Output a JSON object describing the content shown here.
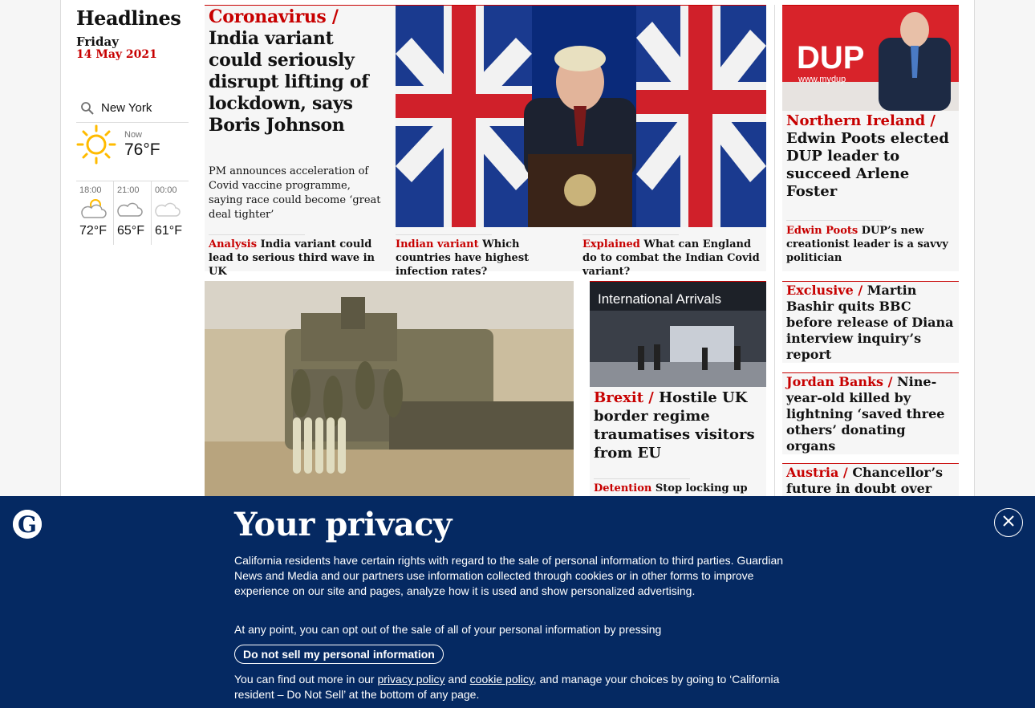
{
  "sidebar": {
    "title": "Headlines",
    "day": "Friday",
    "date": "14 May 2021",
    "weather": {
      "location": "New York",
      "now_label": "Now",
      "now_temp": "76°F",
      "forecast": [
        {
          "time": "18:00",
          "temp": "72°F",
          "icon": "partly-cloudy-icon"
        },
        {
          "time": "21:00",
          "temp": "65°F",
          "icon": "cloud-moon-icon"
        },
        {
          "time": "00:00",
          "temp": "61°F",
          "icon": "cloud-moon-icon"
        }
      ]
    }
  },
  "lead": {
    "kicker": "Coronavirus /",
    "headline": "India variant could seriously disrupt lifting of lockdown, says Boris Johnson",
    "standfirst": "PM announces acceleration of Covid vaccine programme, saying race could become ‘great deal tighter’",
    "sublinks": [
      {
        "kicker": "Analysis",
        "text": "India variant could lead to serious third wave in UK"
      },
      {
        "kicker": "Indian variant",
        "text": "Which countries have highest infection rates?"
      },
      {
        "kicker": "Explained",
        "text": "What can England do to combat the Indian Covid variant?"
      }
    ]
  },
  "ni_story": {
    "image_sign": "DUP",
    "image_url_text": "www.mydup",
    "kicker": "Northern Ireland /",
    "headline": "Edwin Poots elected DUP leader to succeed Arlene Foster",
    "sublink": {
      "kicker": "Edwin Poots",
      "text": "DUP’s new creationist leader is a savvy politician"
    }
  },
  "brexit_story": {
    "image_sign": "International Arrivals",
    "kicker": "Brexit /",
    "headline": "Hostile UK border regime traumatises visitors from EU",
    "sublink": {
      "kicker": "Detention",
      "text": "Stop locking up EU"
    }
  },
  "right_stories": [
    {
      "kicker": "Exclusive /",
      "headline": "Martin Bashir quits BBC before release of Diana interview inquiry’s report"
    },
    {
      "kicker": "Jordan Banks /",
      "headline": "Nine-year-old killed by lightning ‘saved three others’ donating organs"
    },
    {
      "kicker": "Austria /",
      "headline": "Chancellor’s future in doubt over"
    }
  ],
  "privacy": {
    "title": "Your privacy",
    "para1": "California residents have certain rights with regard to the sale of personal information to third parties. Guardian News and Media and our partners use information collected through cookies or in other forms to improve experience on our site and pages, analyze how it is used and show personalized advertising.",
    "para2": "At any point, you can opt out of the sale of all of your personal information by pressing",
    "button": "Do not sell my personal information",
    "para3_pre": "You can find out more in our",
    "privacy_link": "privacy policy",
    "and": "and",
    "cookie_link": "cookie policy",
    "para3_post": ", and manage your choices by going to ‘California resident – Do Not Sell’ at the bottom of any page."
  },
  "colors": {
    "accent": "#c70000",
    "banner": "#052962"
  }
}
